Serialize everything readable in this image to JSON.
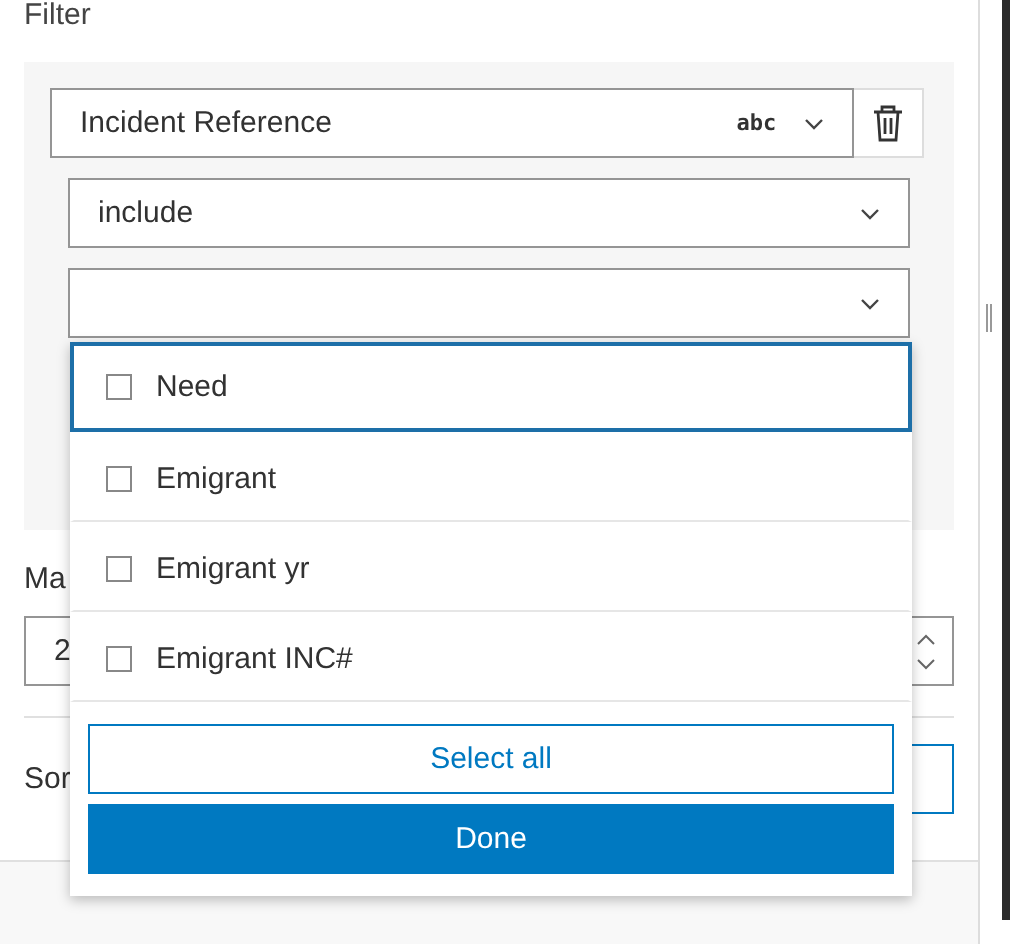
{
  "section_label": "Filter",
  "filter": {
    "field": "Incident Reference",
    "field_type": "abc",
    "operator": "include"
  },
  "max_label": "Ma",
  "max_value": "2",
  "sort_label": "Sor",
  "dropdown": {
    "options": [
      {
        "label": "Need",
        "checked": false,
        "focused": true
      },
      {
        "label": "Emigrant",
        "checked": false,
        "focused": false
      },
      {
        "label": "Emigrant yr",
        "checked": false,
        "focused": false
      },
      {
        "label": "Emigrant INC#",
        "checked": false,
        "focused": false
      }
    ],
    "select_all": "Select all",
    "done": "Done"
  }
}
